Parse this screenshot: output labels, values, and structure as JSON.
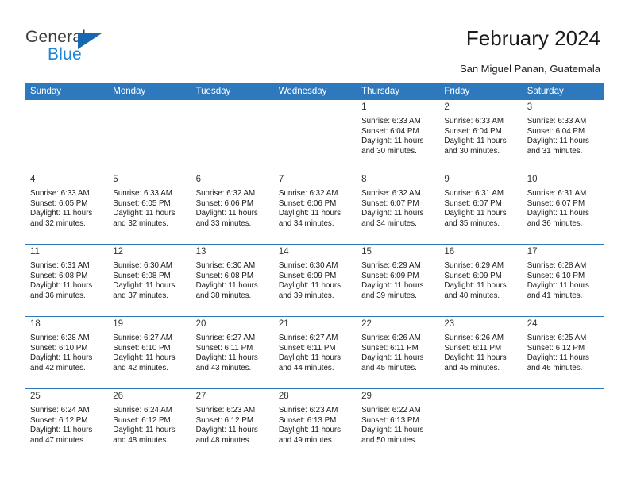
{
  "logo": {
    "word1": "General",
    "word2": "Blue",
    "triangle_icon": "blue-triangle-icon"
  },
  "header": {
    "title": "February 2024",
    "subtitle": "San Miguel Panan, Guatemala"
  },
  "colors": {
    "header_blue": "#2e79bd",
    "logo_blue": "#1e87d8",
    "daynum_band": "#f0f0f0",
    "text": "#1a1a1a"
  },
  "calendar": {
    "weekdays": [
      "Sunday",
      "Monday",
      "Tuesday",
      "Wednesday",
      "Thursday",
      "Friday",
      "Saturday"
    ],
    "weeks": [
      [
        {
          "day": "",
          "lines": []
        },
        {
          "day": "",
          "lines": []
        },
        {
          "day": "",
          "lines": []
        },
        {
          "day": "",
          "lines": []
        },
        {
          "day": "1",
          "lines": [
            "Sunrise: 6:33 AM",
            "Sunset: 6:04 PM",
            "Daylight: 11 hours",
            "and 30 minutes."
          ]
        },
        {
          "day": "2",
          "lines": [
            "Sunrise: 6:33 AM",
            "Sunset: 6:04 PM",
            "Daylight: 11 hours",
            "and 30 minutes."
          ]
        },
        {
          "day": "3",
          "lines": [
            "Sunrise: 6:33 AM",
            "Sunset: 6:04 PM",
            "Daylight: 11 hours",
            "and 31 minutes."
          ]
        }
      ],
      [
        {
          "day": "4",
          "lines": [
            "Sunrise: 6:33 AM",
            "Sunset: 6:05 PM",
            "Daylight: 11 hours",
            "and 32 minutes."
          ]
        },
        {
          "day": "5",
          "lines": [
            "Sunrise: 6:33 AM",
            "Sunset: 6:05 PM",
            "Daylight: 11 hours",
            "and 32 minutes."
          ]
        },
        {
          "day": "6",
          "lines": [
            "Sunrise: 6:32 AM",
            "Sunset: 6:06 PM",
            "Daylight: 11 hours",
            "and 33 minutes."
          ]
        },
        {
          "day": "7",
          "lines": [
            "Sunrise: 6:32 AM",
            "Sunset: 6:06 PM",
            "Daylight: 11 hours",
            "and 34 minutes."
          ]
        },
        {
          "day": "8",
          "lines": [
            "Sunrise: 6:32 AM",
            "Sunset: 6:07 PM",
            "Daylight: 11 hours",
            "and 34 minutes."
          ]
        },
        {
          "day": "9",
          "lines": [
            "Sunrise: 6:31 AM",
            "Sunset: 6:07 PM",
            "Daylight: 11 hours",
            "and 35 minutes."
          ]
        },
        {
          "day": "10",
          "lines": [
            "Sunrise: 6:31 AM",
            "Sunset: 6:07 PM",
            "Daylight: 11 hours",
            "and 36 minutes."
          ]
        }
      ],
      [
        {
          "day": "11",
          "lines": [
            "Sunrise: 6:31 AM",
            "Sunset: 6:08 PM",
            "Daylight: 11 hours",
            "and 36 minutes."
          ]
        },
        {
          "day": "12",
          "lines": [
            "Sunrise: 6:30 AM",
            "Sunset: 6:08 PM",
            "Daylight: 11 hours",
            "and 37 minutes."
          ]
        },
        {
          "day": "13",
          "lines": [
            "Sunrise: 6:30 AM",
            "Sunset: 6:08 PM",
            "Daylight: 11 hours",
            "and 38 minutes."
          ]
        },
        {
          "day": "14",
          "lines": [
            "Sunrise: 6:30 AM",
            "Sunset: 6:09 PM",
            "Daylight: 11 hours",
            "and 39 minutes."
          ]
        },
        {
          "day": "15",
          "lines": [
            "Sunrise: 6:29 AM",
            "Sunset: 6:09 PM",
            "Daylight: 11 hours",
            "and 39 minutes."
          ]
        },
        {
          "day": "16",
          "lines": [
            "Sunrise: 6:29 AM",
            "Sunset: 6:09 PM",
            "Daylight: 11 hours",
            "and 40 minutes."
          ]
        },
        {
          "day": "17",
          "lines": [
            "Sunrise: 6:28 AM",
            "Sunset: 6:10 PM",
            "Daylight: 11 hours",
            "and 41 minutes."
          ]
        }
      ],
      [
        {
          "day": "18",
          "lines": [
            "Sunrise: 6:28 AM",
            "Sunset: 6:10 PM",
            "Daylight: 11 hours",
            "and 42 minutes."
          ]
        },
        {
          "day": "19",
          "lines": [
            "Sunrise: 6:27 AM",
            "Sunset: 6:10 PM",
            "Daylight: 11 hours",
            "and 42 minutes."
          ]
        },
        {
          "day": "20",
          "lines": [
            "Sunrise: 6:27 AM",
            "Sunset: 6:11 PM",
            "Daylight: 11 hours",
            "and 43 minutes."
          ]
        },
        {
          "day": "21",
          "lines": [
            "Sunrise: 6:27 AM",
            "Sunset: 6:11 PM",
            "Daylight: 11 hours",
            "and 44 minutes."
          ]
        },
        {
          "day": "22",
          "lines": [
            "Sunrise: 6:26 AM",
            "Sunset: 6:11 PM",
            "Daylight: 11 hours",
            "and 45 minutes."
          ]
        },
        {
          "day": "23",
          "lines": [
            "Sunrise: 6:26 AM",
            "Sunset: 6:11 PM",
            "Daylight: 11 hours",
            "and 45 minutes."
          ]
        },
        {
          "day": "24",
          "lines": [
            "Sunrise: 6:25 AM",
            "Sunset: 6:12 PM",
            "Daylight: 11 hours",
            "and 46 minutes."
          ]
        }
      ],
      [
        {
          "day": "25",
          "lines": [
            "Sunrise: 6:24 AM",
            "Sunset: 6:12 PM",
            "Daylight: 11 hours",
            "and 47 minutes."
          ]
        },
        {
          "day": "26",
          "lines": [
            "Sunrise: 6:24 AM",
            "Sunset: 6:12 PM",
            "Daylight: 11 hours",
            "and 48 minutes."
          ]
        },
        {
          "day": "27",
          "lines": [
            "Sunrise: 6:23 AM",
            "Sunset: 6:12 PM",
            "Daylight: 11 hours",
            "and 48 minutes."
          ]
        },
        {
          "day": "28",
          "lines": [
            "Sunrise: 6:23 AM",
            "Sunset: 6:13 PM",
            "Daylight: 11 hours",
            "and 49 minutes."
          ]
        },
        {
          "day": "29",
          "lines": [
            "Sunrise: 6:22 AM",
            "Sunset: 6:13 PM",
            "Daylight: 11 hours",
            "and 50 minutes."
          ]
        },
        {
          "day": "",
          "lines": []
        },
        {
          "day": "",
          "lines": []
        }
      ]
    ]
  }
}
